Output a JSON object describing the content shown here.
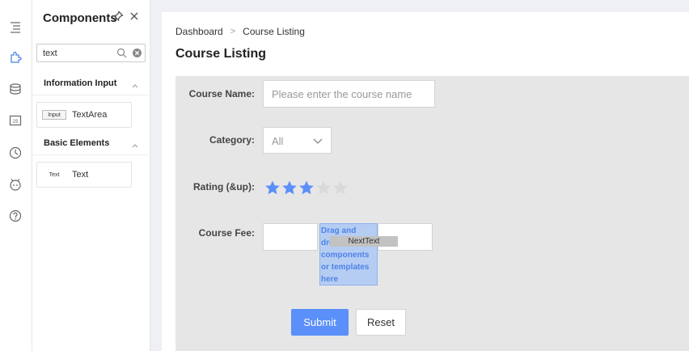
{
  "rail": {
    "icons": [
      "outline-icon",
      "components-icon",
      "datasource-icon",
      "js-icon",
      "history-icon",
      "assistant-icon",
      "help-icon"
    ],
    "js_text": "JS"
  },
  "panel": {
    "title": "Components",
    "search": {
      "value": "text",
      "placeholder": ""
    },
    "sections": [
      {
        "label": "Information Input",
        "items": [
          {
            "thumb": "Input",
            "label": "TextArea"
          }
        ]
      },
      {
        "label": "Basic Elements",
        "items": [
          {
            "thumb": "Text",
            "label": "Text"
          }
        ]
      }
    ]
  },
  "breadcrumb": {
    "items": [
      "Dashboard",
      "Course Listing"
    ],
    "separator": ">"
  },
  "page_title": "Course Listing",
  "form": {
    "course_name": {
      "label": "Course Name:",
      "placeholder": "Please enter the course name",
      "value": ""
    },
    "category": {
      "label": "Category:",
      "value": "All"
    },
    "rating": {
      "label": "Rating (&up):",
      "value": 3,
      "max": 5
    },
    "course_fee": {
      "label": "Course Fee:"
    },
    "drop_zone_text": "Drag and drop components or templates here",
    "drag_chip_text": "NextText",
    "submit_label": "Submit",
    "reset_label": "Reset"
  },
  "colors": {
    "accent": "#5b8ff9",
    "star_filled": "#5b8ff9",
    "star_empty": "#d9d9d9",
    "drop_zone_bg": "#b6cdf3",
    "drop_zone_text": "#4d82e8"
  }
}
